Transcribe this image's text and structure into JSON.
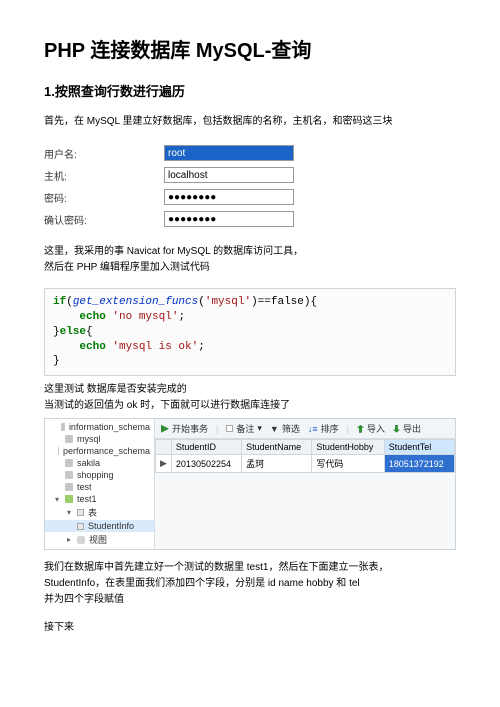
{
  "title": "PHP 连接数据库 MySQL-查询",
  "section1": {
    "heading": "1.按照查询行数进行遍历",
    "intro": "首先，在 MySQL 里建立好数据库，包括数据库的名称，主机名，和密码这三块"
  },
  "form": {
    "labels": {
      "user": "用户名:",
      "host": "主机:",
      "pwd": "密码:",
      "pwd2": "确认密码:"
    },
    "values": {
      "user": "root",
      "host": "localhost",
      "pwd": "●●●●●●●●",
      "pwd2": "●●●●●●●●"
    }
  },
  "para2a": "这里，我采用的事 Navicat for MySQL 的数据库访问工具，",
  "para2b": "然后在 PHP 编辑程序里加入测试代码",
  "code": {
    "l1_if": "if",
    "l1_fn": "get_extension_funcs",
    "l1_arg": "'mysql'",
    "l1_cmp": "==false",
    "l2_echo": "echo",
    "l2_str": "'no mysql'",
    "l3_else": "else",
    "l4_echo": "echo",
    "l4_str": "'mysql is ok'"
  },
  "para3a": "这里测试 数据库是否安装完成的",
  "para3b": "当测试的返回值为 ok 时，下面就可以进行数据库连接了",
  "navicat": {
    "tree": {
      "items": [
        {
          "label": "information_schema",
          "type": "db-g"
        },
        {
          "label": "mysql",
          "type": "db-g"
        },
        {
          "label": "performance_schema",
          "type": "db-g"
        },
        {
          "label": "sakila",
          "type": "db-g"
        },
        {
          "label": "shopping",
          "type": "db-g"
        },
        {
          "label": "test",
          "type": "db-g"
        },
        {
          "label": "test1",
          "type": "db",
          "expanded": true
        },
        {
          "label": "表",
          "type": "folder",
          "sub": true,
          "expanded": true
        },
        {
          "label": "StudentInfo",
          "type": "table",
          "sub2": true,
          "selected": true
        },
        {
          "label": "视图",
          "type": "view",
          "sub": true
        }
      ]
    },
    "toolbar": {
      "start": "开始事务",
      "note": "备注",
      "filter": "筛选",
      "sort": "排序",
      "import": "导入",
      "export": "导出"
    },
    "grid": {
      "columns": [
        "StudentID",
        "StudentName",
        "StudentHobby",
        "StudentTel"
      ],
      "row": {
        "marker": "▶",
        "id": "20130502254",
        "name": "孟珂",
        "hobby": "写代码",
        "tel": "18051372192"
      }
    }
  },
  "para4a": "我们在数据库中首先建立好一个测试的数据里 test1，然后在下面建立一张表，",
  "para4b": "StudentInfo，在表里面我们添加四个字段，分别是 id name hobby 和 tel",
  "para4c": "并为四个字段赋值",
  "para5": "接下来"
}
